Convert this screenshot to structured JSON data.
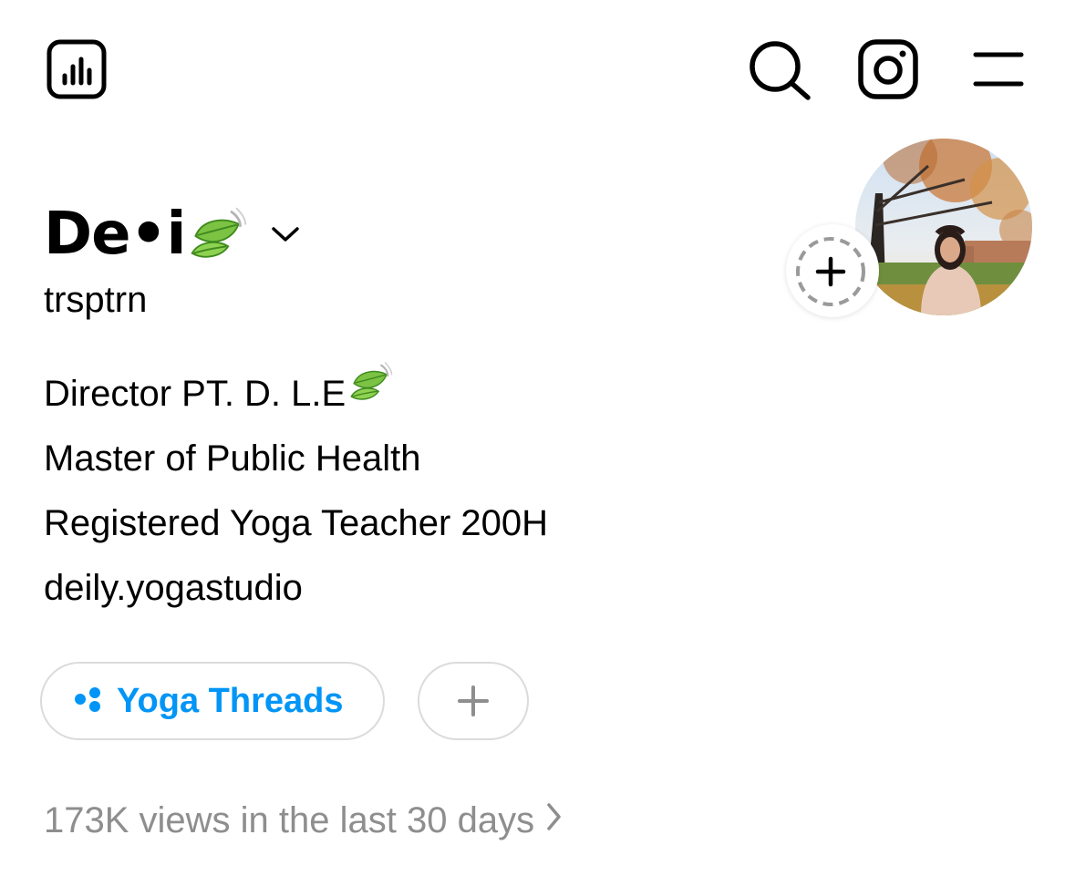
{
  "header": {
    "left_icon": "insights-icon",
    "right_icons": [
      "search-icon",
      "threads-icon",
      "menu-icon"
    ]
  },
  "profile": {
    "display_name": "De•i",
    "name_emoji": "leaf-icon",
    "username": "trsptrn",
    "avatar": "profile-photo",
    "story_add_icon": "plus-icon"
  },
  "bio": {
    "lines": [
      "Director PT. D. L.E",
      "Master of Public Health",
      "Registered Yoga Teacher 200H",
      "deily.yogastudio"
    ]
  },
  "chips": {
    "threads_label": "Yoga Threads",
    "add_label": "+"
  },
  "stats": {
    "views_text": "173K views in the last 30 days"
  },
  "colors": {
    "accent": "#0095f6",
    "muted_text": "#8e8e8e",
    "chip_border": "#dbdbdb"
  }
}
